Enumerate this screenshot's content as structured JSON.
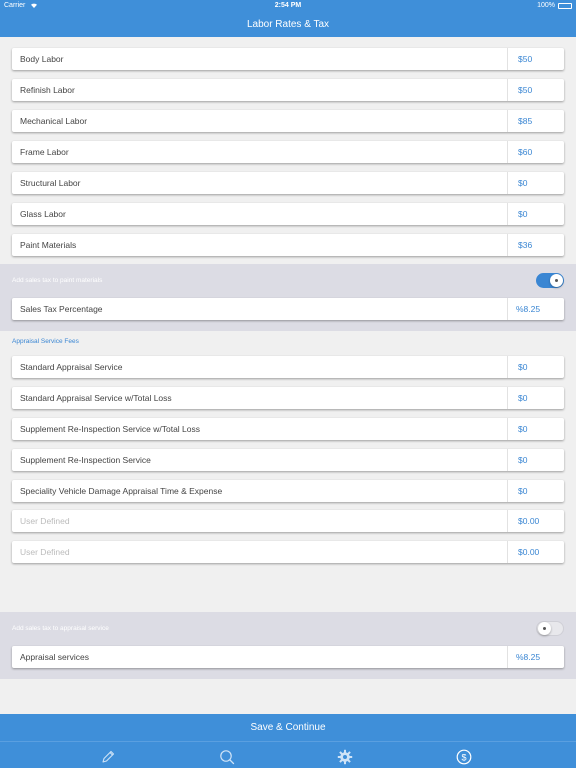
{
  "status": {
    "carrier": "Carrier",
    "time": "2:54 PM",
    "battery": "100%"
  },
  "header": {
    "title": "Labor Rates & Tax"
  },
  "labor": [
    {
      "label": "Body Labor",
      "value": "$50"
    },
    {
      "label": "Refinish Labor",
      "value": "$50"
    },
    {
      "label": "Mechanical Labor",
      "value": "$85"
    },
    {
      "label": "Frame Labor",
      "value": "$60"
    },
    {
      "label": "Structural Labor",
      "value": "$0"
    },
    {
      "label": "Glass Labor",
      "value": "$0"
    },
    {
      "label": "Paint Materials",
      "value": "$36"
    }
  ],
  "paint_tax": {
    "label": "Add sales tax to paint materials",
    "enabled": true
  },
  "sales_tax": {
    "label": "Sales Tax Percentage",
    "value": "%8.25"
  },
  "fees": {
    "section_label": "Appraisal Service Fees",
    "items": [
      {
        "label": "Standard Appraisal Service",
        "value": "$0"
      },
      {
        "label": "Standard Appraisal Service w/Total Loss",
        "value": "$0"
      },
      {
        "label": "Supplement Re-Inspection Service w/Total Loss",
        "value": "$0"
      },
      {
        "label": "Supplement Re-Inspection Service",
        "value": "$0"
      },
      {
        "label": "Speciality Vehicle Damage Appraisal Time & Expense",
        "value": "$0"
      }
    ],
    "user_defined": [
      {
        "placeholder": "User Defined",
        "value": "$0.00"
      },
      {
        "placeholder": "User Defined",
        "value": "$0.00"
      }
    ]
  },
  "appraisal_tax": {
    "label": "Add sales tax to appraisal service",
    "enabled": false
  },
  "appraisal_services": {
    "label": "Appraisal services",
    "value": "%8.25"
  },
  "save": {
    "label": "Save & Continue"
  },
  "tabs": [
    {
      "icon": "pencil-icon"
    },
    {
      "icon": "search-icon"
    },
    {
      "icon": "gear-icon"
    },
    {
      "icon": "dollar-icon"
    }
  ],
  "colors": {
    "accent": "#3f8fd9",
    "value_text": "#3a86d3",
    "band": "#dcdce4"
  }
}
